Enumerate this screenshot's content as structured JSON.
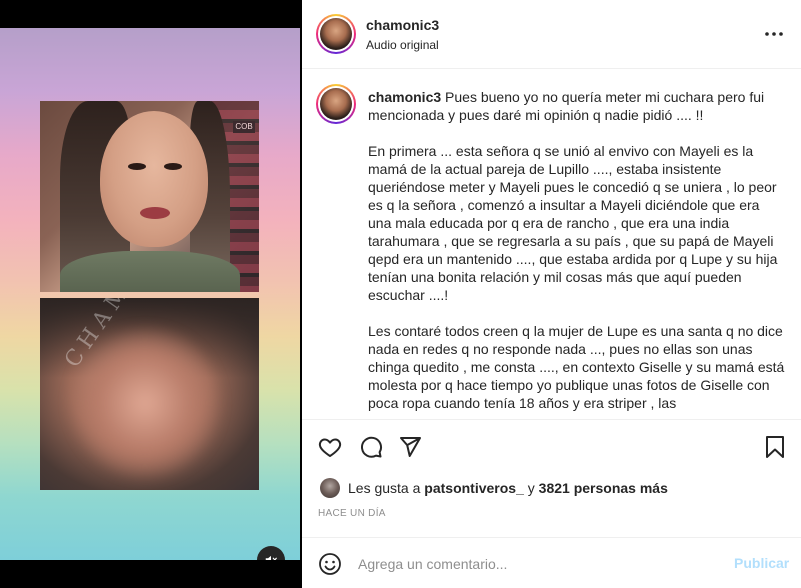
{
  "post": {
    "username": "chamonic3",
    "audio_label": "Audio original",
    "more_icon": "more-horizontal-icon"
  },
  "media": {
    "watermark": "CHAMO",
    "shop_sign": "COB",
    "mute_icon": "speaker-muted-icon"
  },
  "caption": {
    "username": "chamonic3",
    "intro": " Pues bueno yo no quería meter mi cuchara pero fui mencionada y pues daré mi opinión q nadie pidió .... !!",
    "paragraph_2": "En primera ... esta señora q se unió al envivo con Mayeli es la mamá de la actual pareja de Lupillo ...., estaba insistente queriéndose meter y Mayeli pues le concedió q se uniera , lo peor es q la señora , comenzó a insultar a Mayeli diciéndole que era una mala educada por q era de rancho , que era una india tarahumara , que se regresarla a su país , que su papá de Mayeli qepd era un mantenido ...., que estaba ardida por q Lupe y su hija tenían una bonita relación y mil cosas más que aquí pueden escuchar ....!",
    "paragraph_3": "Les contaré todos creen q la mujer de Lupe es una santa q no dice nada en redes q no responde nada ..., pues no ellas son unas chinga quedito , me consta ...., en contexto Giselle y su mamá está molesta por q hace tiempo yo publique unas fotos de Giselle con poca ropa cuando tenía 18 años y era striper , las"
  },
  "actions": {
    "like_icon": "heart-icon",
    "comment_icon": "comment-icon",
    "share_icon": "send-icon",
    "save_icon": "bookmark-icon"
  },
  "likes": {
    "prefix": "Les gusta a ",
    "user": "patsontiveros_",
    "middle": " y ",
    "count": "3821 personas más"
  },
  "timestamp": "HACE UN DÍA",
  "comment": {
    "emoji_icon": "emoji-icon",
    "placeholder": "Agrega un comentario...",
    "post_label": "Publicar"
  }
}
